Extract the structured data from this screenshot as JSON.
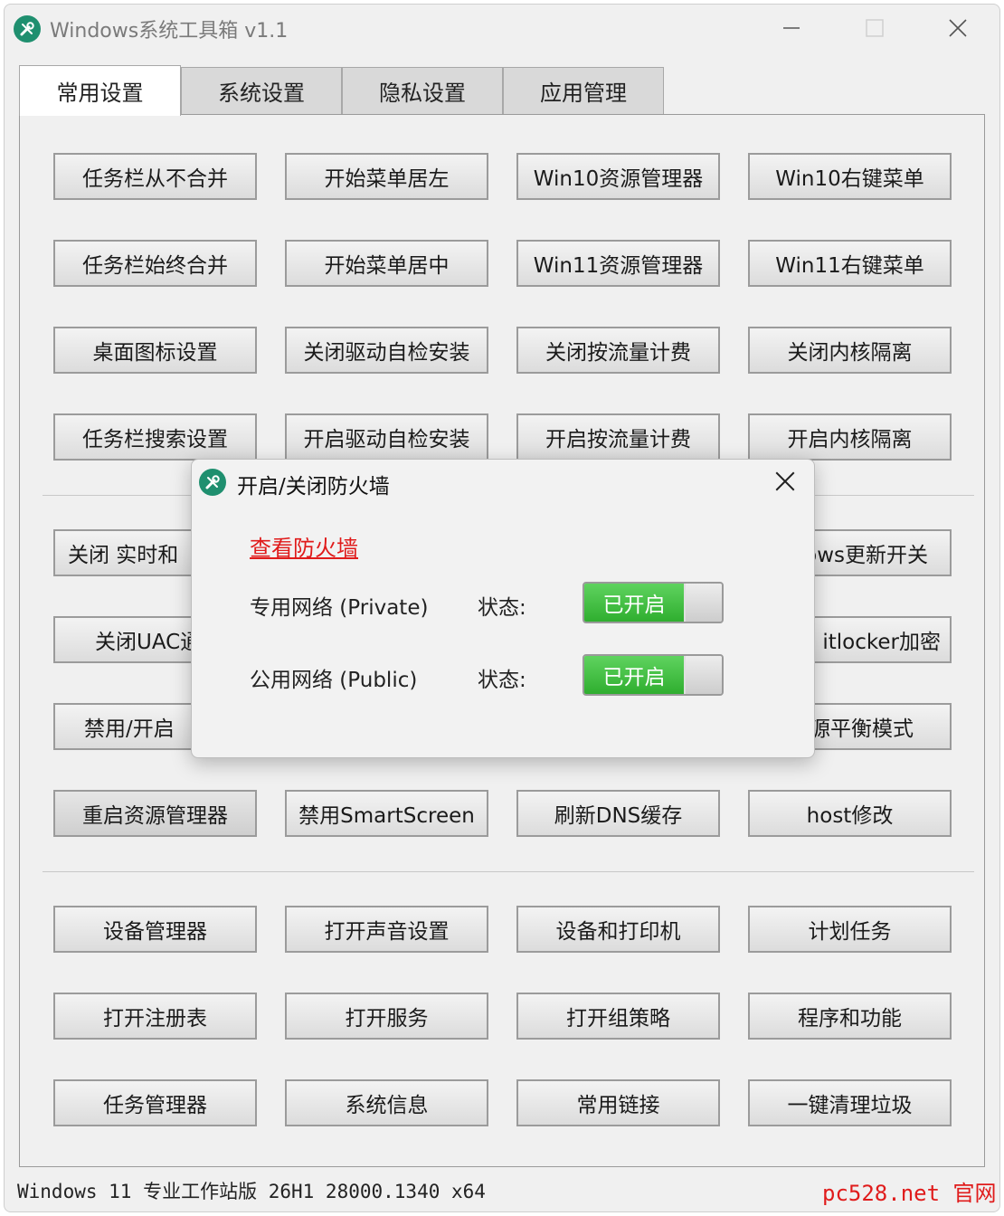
{
  "app": {
    "title": "Windows系统工具箱 v1.1",
    "icon": "tools-icon",
    "controls": {
      "minimize": "minimize-icon",
      "maximize": "maximize-icon",
      "close": "close-icon"
    }
  },
  "tabs": [
    {
      "label": "常用设置",
      "active": true
    },
    {
      "label": "系统设置",
      "active": false
    },
    {
      "label": "隐私设置",
      "active": false
    },
    {
      "label": "应用管理",
      "active": false
    }
  ],
  "buttons": {
    "r1": [
      "任务栏从不合并",
      "开始菜单居左",
      "Win10资源管理器",
      "Win10右键菜单"
    ],
    "r2": [
      "任务栏始终合并",
      "开始菜单居中",
      "Win11资源管理器",
      "Win11右键菜单"
    ],
    "r3": [
      "桌面图标设置",
      "关闭驱动自检安装",
      "关闭按流量计费",
      "关闭内核隔离"
    ],
    "r4": [
      "任务栏搜索设置",
      "开启驱动自检安装",
      "开启按流量计费",
      "开启内核隔离"
    ],
    "r5": [
      "关闭 实时和",
      "ows更新开关"
    ],
    "r6": [
      "关闭UAC通",
      "itlocker加密"
    ],
    "r7": [
      "禁用/开启",
      "源平衡模式"
    ],
    "r8": [
      "重启资源管理器",
      "禁用SmartScreen",
      "刷新DNS缓存",
      "host修改"
    ],
    "r9": [
      "设备管理器",
      "打开声音设置",
      "设备和打印机",
      "计划任务"
    ],
    "r10": [
      "打开注册表",
      "打开服务",
      "打开组策略",
      "程序和功能"
    ],
    "r11": [
      "任务管理器",
      "系统信息",
      "常用链接",
      "一键清理垃圾"
    ]
  },
  "status_bar": {
    "system_info": "Windows 11 专业工作站版 26H1 28000.1340 x64",
    "site_link": "pc528.net 官网"
  },
  "dialog": {
    "title": "开启/关闭防火墙",
    "link": "查看防火墙",
    "private": {
      "label": "专用网络 (Private)",
      "state_label": "状态:",
      "toggle_text": "已开启"
    },
    "public": {
      "label": "公用网络 (Public)",
      "state_label": "状态:",
      "toggle_text": "已开启"
    }
  },
  "colors": {
    "accent": "#1f8f6f",
    "link": "#e01b1b",
    "toggle_on": "#3cbf3c"
  }
}
